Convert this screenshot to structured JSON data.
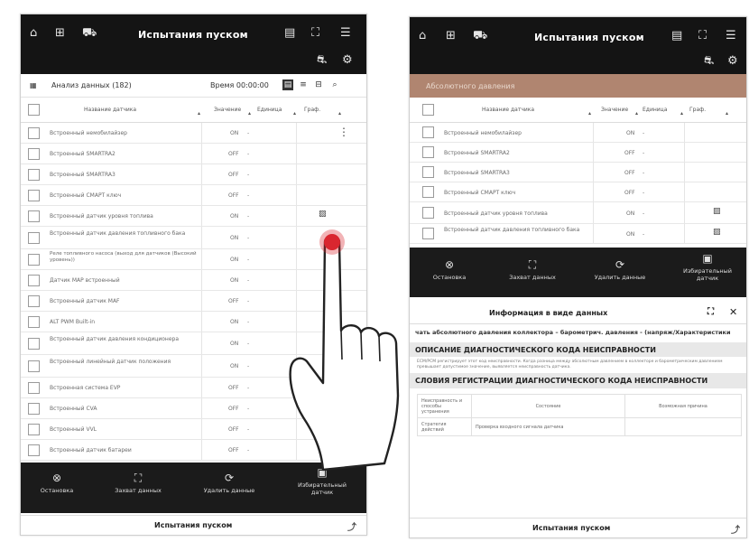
{
  "colors": {
    "topbar": "#141414",
    "accent_brown": "#b08570",
    "tap_red": "#d9262f"
  },
  "left": {
    "title": "Испытания пуском",
    "toolbar": {
      "data_count": "Анализ данных (182)",
      "timer": "Время 00:00:00"
    },
    "columns": [
      "Название датчика",
      "Значение",
      "Единица",
      "Граф."
    ],
    "rows": [
      {
        "name": "Встроенный немобилайзер",
        "value": "ON"
      },
      {
        "name": "Встроенный SMARTRA2",
        "value": "OFF"
      },
      {
        "name": "Встроенный SMARTRA3",
        "value": "OFF"
      },
      {
        "name": "Встроенный СМАРТ ключ",
        "value": "OFF"
      },
      {
        "name": "Встроенный датчик уровня топлива",
        "value": "ON"
      },
      {
        "name": "Встроенный датчик давления топливного бака",
        "value": "ON"
      },
      {
        "name": "Реле топливного насоса (выход для датчиков (Высокий уровень))",
        "value": "ON"
      },
      {
        "name": "Датчик MAP встроенный",
        "value": "ON"
      },
      {
        "name": "Встроенный датчик MAF",
        "value": "OFF"
      },
      {
        "name": "ALT PWM Built-in",
        "value": "ON"
      },
      {
        "name": "Встроенный датчик давления кондиционера",
        "value": "ON"
      },
      {
        "name": "Встроенный линейный датчик положения",
        "value": "ON"
      },
      {
        "name": "Встроенная система EVP",
        "value": "OFF"
      },
      {
        "name": "Встроенный CVA",
        "value": "OFF"
      },
      {
        "name": "Встроенный VVL",
        "value": "OFF"
      },
      {
        "name": "Встроенный датчик батареи",
        "value": "OFF"
      }
    ],
    "actions": [
      "Остановка",
      "Захват данных",
      "Удалить данные",
      "Избирательный датчик"
    ],
    "bottom_title": "Испытания пуском"
  },
  "right": {
    "title": "Испытания пуском",
    "selected_row_label": "Абсолютного давления",
    "columns": [
      "Название датчика",
      "Значение",
      "Единица",
      "Граф."
    ],
    "rows": [
      {
        "name": "Встроенный немобилайзер",
        "value": "ON"
      },
      {
        "name": "Встроенный SMARTRA2",
        "value": "OFF"
      },
      {
        "name": "Встроенный SMARTRA3",
        "value": "OFF"
      },
      {
        "name": "Встроенный СМАРТ ключ",
        "value": "OFF"
      },
      {
        "name": "Встроенный датчик уровня топлива",
        "value": "ON"
      },
      {
        "name": "Встроенный датчик давления топливного бака",
        "value": "ON"
      }
    ],
    "actions": [
      "Остановка",
      "Захват данных",
      "Удалить данные",
      "Избирательный датчик"
    ],
    "info": {
      "header": "Информация в виде данных",
      "intro": "чать абсолютного давления коллектора – барометрич. давления - (напряж/Характеристики",
      "section1": "ОПИСАНИЕ ДИАГНОСТИЧЕСКОГО КОДА НЕИСПРАВНОСТИ",
      "desc": "ECM/PCM регистрирует этот код неисправности. Когда разница между абсолютным давлением в коллекторе и барометрическим давлением превышает допустимое значение, выявляется неисправность датчика.",
      "section2": "СЛОВИЯ РЕГИСТРАЦИИ ДИАГНОСТИЧЕСКОГО КОДА НЕИСПРАВНОСТИ",
      "table_headers": [
        "Неисправность и способы устранения",
        "Состояние",
        "Возможная причина"
      ],
      "table_row": [
        "Стратегия действий",
        "Проверка входного сигнала датчика"
      ]
    },
    "bottom_title": "Испытания пуском"
  }
}
